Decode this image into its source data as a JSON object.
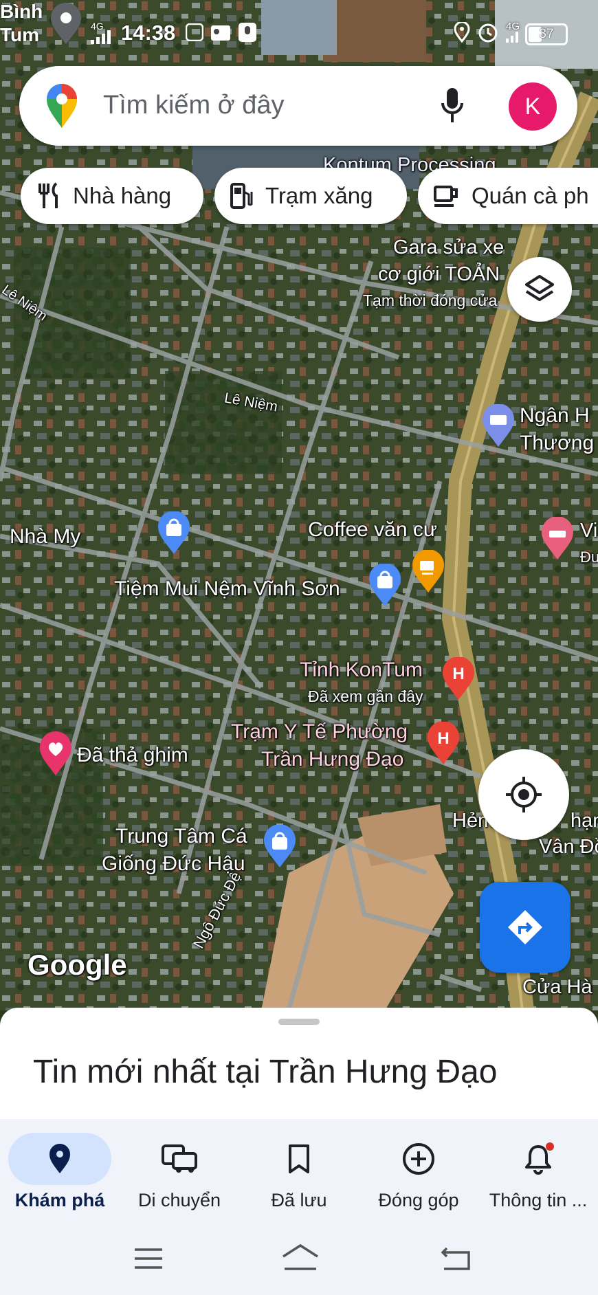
{
  "status_bar": {
    "location_name": "Bình\nTum",
    "time": "14:38",
    "net_left": "4G",
    "net_right": "4G",
    "battery": "37"
  },
  "search": {
    "placeholder": "Tìm kiếm ở đây",
    "avatar_letter": "K"
  },
  "chips": [
    {
      "label": "Nhà hàng",
      "icon": "restaurant-icon"
    },
    {
      "label": "Trạm xăng",
      "icon": "gas-station-icon"
    },
    {
      "label": "Quán cà ph",
      "icon": "coffee-icon"
    }
  ],
  "map": {
    "top_label": "Kontum Processing",
    "garage": {
      "line1": "Gara sửa xe",
      "line2": "cơ giới TOẢN",
      "line3": "Tạm thời đóng cửa"
    },
    "street_le_niem_1": "Lê Niệm",
    "street_le_niem_2": "Lê Niệm",
    "bank": {
      "line1": "Ngân H",
      "line2": "Thương"
    },
    "hotel_partial": {
      "line1": "Vi",
      "line2": "Đu"
    },
    "nha_my": "Nhà My",
    "coffee": "Coffee văn cư",
    "shop_mui_nem": "Tiệm Mui Nệm Vĩnh Sơn",
    "hospital": {
      "line1": "Tỉnh KonTum",
      "line2": "Đã xem gần đây"
    },
    "health_station": {
      "line1": "Trạm Y Tế Phường",
      "line2": "Trần Hưng Đạo"
    },
    "dropped_pin": "Đã thả ghim",
    "hem": {
      "line1": "Hẻm",
      "line2": "hạn",
      "line3": "Vân Đồn"
    },
    "fish_center": {
      "line1": "Trung Tâm Cá",
      "line2": "Giống Đức Hậu"
    },
    "street_ngo_duc_de": "Ngô Đức Đệ",
    "google_logo": "Google",
    "cua_ha": "Cửa Hà"
  },
  "sheet": {
    "title": "Tin mới nhất tại Trần Hưng Đạo"
  },
  "nav": [
    {
      "label": "Khám phá",
      "icon": "explore-pin-icon",
      "active": true
    },
    {
      "label": "Di chuyển",
      "icon": "commute-icon",
      "active": false
    },
    {
      "label": "Đã lưu",
      "icon": "bookmark-icon",
      "active": false
    },
    {
      "label": "Đóng góp",
      "icon": "add-circle-icon",
      "active": false
    },
    {
      "label": "Thông tin ...",
      "icon": "bell-icon",
      "active": false
    }
  ],
  "colors": {
    "accent": "#1a73e8",
    "avatar": "#e6196b",
    "nav_active_bg": "#d3e3fd",
    "nav_active_icon": "#0b1f4d"
  }
}
